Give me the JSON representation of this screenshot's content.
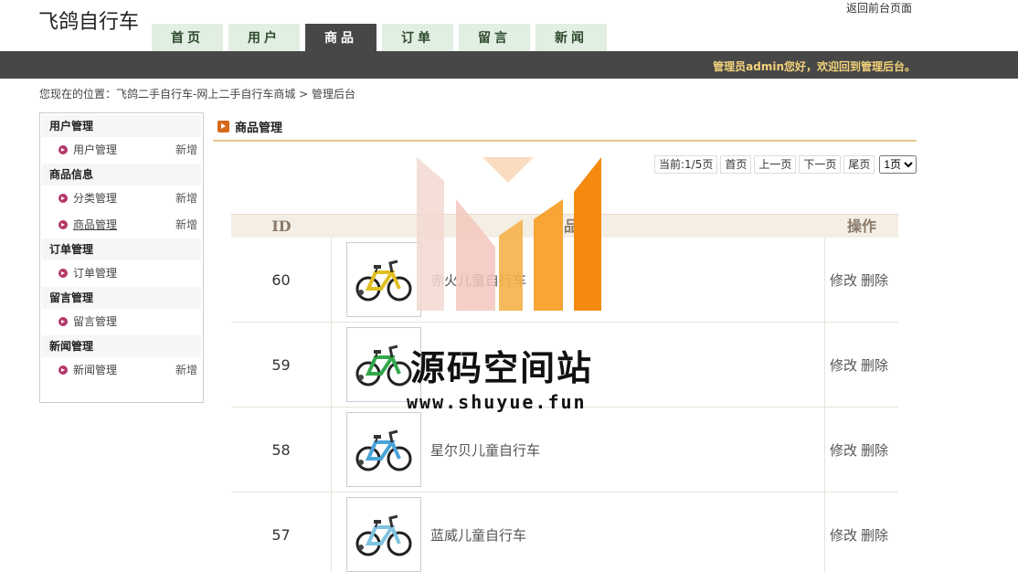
{
  "site": {
    "title": "飞鸽自行车",
    "back_link": "返回前台页面"
  },
  "nav": {
    "tabs": [
      {
        "label": "首页",
        "active": false
      },
      {
        "label": "用户",
        "active": false
      },
      {
        "label": "商品",
        "active": true
      },
      {
        "label": "订单",
        "active": false
      },
      {
        "label": "留言",
        "active": false
      },
      {
        "label": "新闻",
        "active": false
      }
    ]
  },
  "topbar": {
    "welcome": "管理员admin您好，欢迎回到管理后台。"
  },
  "breadcrumb": "您现在的位置：飞鸽二手自行车-网上二手自行车商城 > 管理后台",
  "sidebar": {
    "groups": [
      {
        "title": "用户管理",
        "items": [
          {
            "label": "用户管理",
            "add": "新增"
          }
        ]
      },
      {
        "title": "商品信息",
        "items": [
          {
            "label": "分类管理",
            "add": "新增"
          },
          {
            "label": "商品管理",
            "add": "新增"
          }
        ]
      },
      {
        "title": "订单管理",
        "items": [
          {
            "label": "订单管理",
            "add": ""
          }
        ]
      },
      {
        "title": "留言管理",
        "items": [
          {
            "label": "留言管理",
            "add": ""
          }
        ]
      },
      {
        "title": "新闻管理",
        "items": [
          {
            "label": "新闻管理",
            "add": "新增"
          }
        ]
      }
    ]
  },
  "panel": {
    "title": "商品管理"
  },
  "pager": {
    "current": "当前:1/5页",
    "first": "首页",
    "prev": "上一页",
    "next": "下一页",
    "last": "尾页",
    "select_value": "1页"
  },
  "table": {
    "headers": {
      "id": "ID",
      "name": "品称",
      "op": "操作"
    },
    "rows": [
      {
        "id": "60",
        "name": "赤火儿童自行车",
        "edit": "修改",
        "del": "删除",
        "bike_color": "#e0c020"
      },
      {
        "id": "59",
        "name": "",
        "edit": "修改",
        "del": "删除",
        "bike_color": "#33a84a"
      },
      {
        "id": "58",
        "name": "星尔贝儿童自行车",
        "edit": "修改",
        "del": "删除",
        "bike_color": "#4aa3d8"
      },
      {
        "id": "57",
        "name": "蓝威儿童自行车",
        "edit": "修改",
        "del": "删除",
        "bike_color": "#7fc4e0"
      }
    ]
  },
  "watermark": {
    "text": "源码空间站",
    "url": "www.shuyue.fun"
  }
}
